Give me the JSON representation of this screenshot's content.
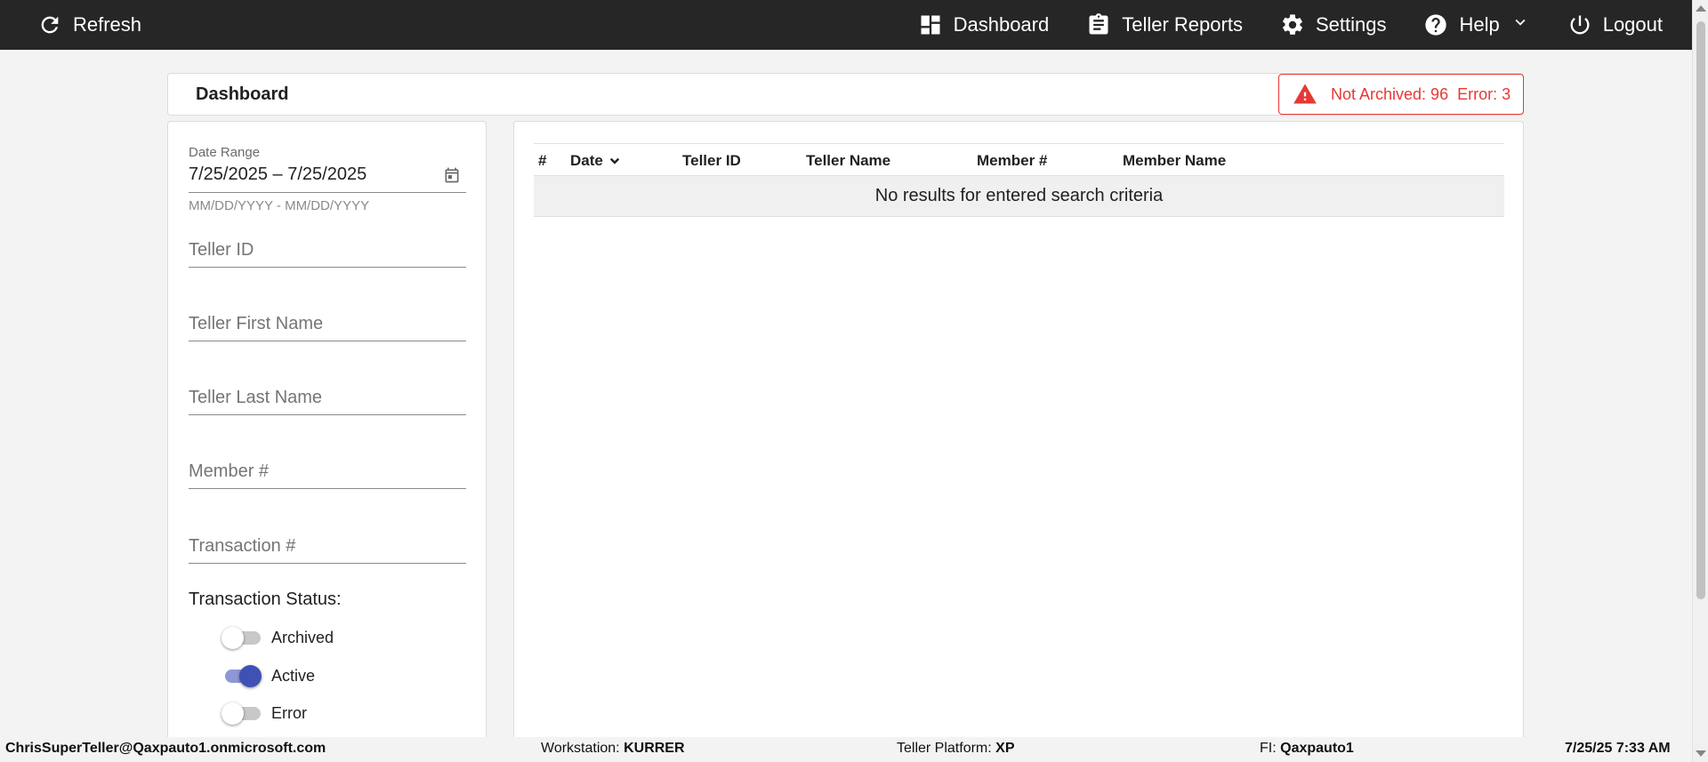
{
  "nav": {
    "refresh_label": "Refresh",
    "dashboard_label": "Dashboard",
    "teller_reports_label": "Teller Reports",
    "settings_label": "Settings",
    "help_label": "Help",
    "logout_label": "Logout"
  },
  "header": {
    "title": "Dashboard",
    "alert": {
      "not_archived": "Not Archived: 96",
      "error": "Error: 3",
      "color": "#e53935"
    }
  },
  "filters": {
    "date_range_label": "Date Range",
    "date_range_value": "7/25/2025 – 7/25/2025",
    "date_hint": "MM/DD/YYYY - MM/DD/YYYY",
    "teller_id_placeholder": "Teller ID",
    "teller_first_name_placeholder": "Teller First Name",
    "teller_last_name_placeholder": "Teller Last Name",
    "member_number_placeholder": "Member #",
    "transaction_number_placeholder": "Transaction #",
    "status_label": "Transaction Status:",
    "statuses": [
      {
        "label": "Archived",
        "on": false
      },
      {
        "label": "Active",
        "on": true
      },
      {
        "label": "Error",
        "on": false
      }
    ],
    "accent_color": "#3f51b5"
  },
  "table": {
    "columns": [
      "#",
      "Date",
      "Teller ID",
      "Teller Name",
      "Member #",
      "Member Name"
    ],
    "sort_column": "Date",
    "empty_message": "No results for entered search criteria"
  },
  "status_bar": {
    "user": "ChrisSuperTeller@Qaxpauto1.onmicrosoft.com",
    "workstation_label": "Workstation:",
    "workstation_value": "KURRER",
    "platform_label": "Teller Platform:",
    "platform_value": "XP",
    "fi_label": "FI:",
    "fi_value": "Qaxpauto1",
    "datetime": "7/25/25 7:33 AM"
  }
}
